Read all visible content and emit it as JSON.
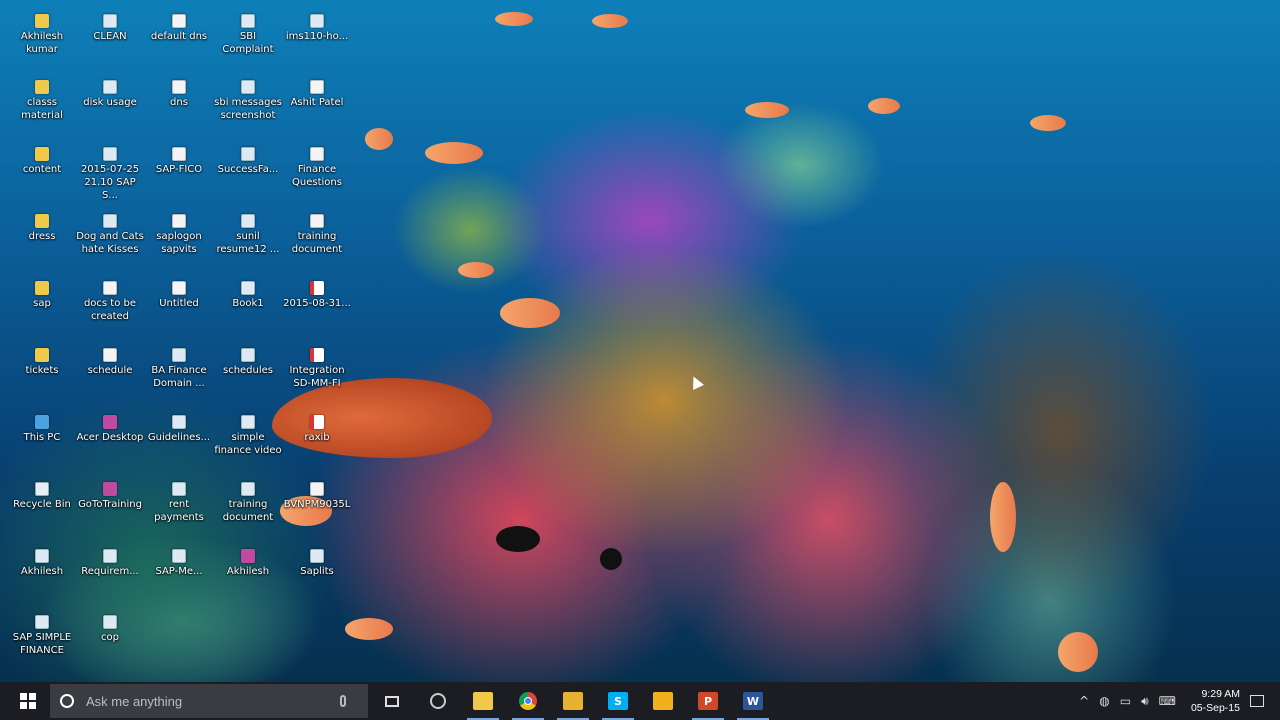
{
  "desktop": {
    "icons": [
      {
        "label": "Akhilesh\nkumar",
        "type": "folder"
      },
      {
        "label": "CLEAN",
        "type": "shortcut"
      },
      {
        "label": "default dns",
        "type": "doc"
      },
      {
        "label": "SBI\nComplaint",
        "type": "shortcut"
      },
      {
        "label": "ims110-ho...",
        "type": "shortcut"
      },
      {
        "label": "classs\nmaterial",
        "type": "folder"
      },
      {
        "label": "disk usage",
        "type": "shortcut"
      },
      {
        "label": "dns",
        "type": "doc"
      },
      {
        "label": "sbi messages\nscreenshot",
        "type": "shortcut"
      },
      {
        "label": "Ashit Patel",
        "type": "doc"
      },
      {
        "label": "content",
        "type": "folder"
      },
      {
        "label": "2015-07-25\n21.10 SAP S...",
        "type": "shortcut"
      },
      {
        "label": "SAP-FICO",
        "type": "doc"
      },
      {
        "label": "SuccessFa...",
        "type": "shortcut"
      },
      {
        "label": "Finance\nQuestions",
        "type": "doc"
      },
      {
        "label": "dress",
        "type": "folder"
      },
      {
        "label": "Dog and Cats\nhate Kisses",
        "type": "shortcut"
      },
      {
        "label": "saplogon\nsapvits",
        "type": "doc"
      },
      {
        "label": "sunil\nresume12 ...",
        "type": "shortcut"
      },
      {
        "label": "training\ndocument",
        "type": "doc"
      },
      {
        "label": "sap",
        "type": "folder"
      },
      {
        "label": "docs to be\ncreated",
        "type": "doc"
      },
      {
        "label": "Untitled",
        "type": "doc"
      },
      {
        "label": "Book1",
        "type": "shortcut"
      },
      {
        "label": "2015-08-31...",
        "type": "pdf"
      },
      {
        "label": "tickets",
        "type": "folder"
      },
      {
        "label": "schedule",
        "type": "doc"
      },
      {
        "label": "BA Finance\nDomain ...",
        "type": "shortcut"
      },
      {
        "label": "schedules",
        "type": "shortcut"
      },
      {
        "label": "Integration\nSD-MM-FI",
        "type": "pdf"
      },
      {
        "label": "This PC",
        "type": "pc"
      },
      {
        "label": "Acer Desktop",
        "type": "app"
      },
      {
        "label": "Guidelines...",
        "type": "shortcut"
      },
      {
        "label": "simple\nfinance video",
        "type": "shortcut"
      },
      {
        "label": "raxib",
        "type": "pdf"
      },
      {
        "label": "Recycle Bin",
        "type": "bin"
      },
      {
        "label": "GoToTraining",
        "type": "app"
      },
      {
        "label": "rent\npayments",
        "type": "shortcut"
      },
      {
        "label": "training\ndocument",
        "type": "shortcut"
      },
      {
        "label": "BVNPM9035L",
        "type": "doc"
      },
      {
        "label": "Akhilesh",
        "type": "shortcut"
      },
      {
        "label": "Requirem...",
        "type": "shortcut"
      },
      {
        "label": "SAP-Me...",
        "type": "shortcut"
      },
      {
        "label": "Akhilesh",
        "type": "app"
      },
      {
        "label": "Saplits",
        "type": "shortcut"
      },
      {
        "label": "SAP SIMPLE\nFINANCE",
        "type": "shortcut"
      },
      {
        "label": "cop",
        "type": "shortcut"
      }
    ]
  },
  "taskbar": {
    "search_placeholder": "Ask me anything",
    "apps": [
      {
        "name": "cortana-search-app",
        "icon": "search-icon",
        "active": false
      },
      {
        "name": "file-explorer",
        "icon": "folder-icon",
        "active": true,
        "color": "#f0c94a"
      },
      {
        "name": "chrome",
        "icon": "chrome-icon",
        "active": true
      },
      {
        "name": "sticky-app",
        "icon": "app-icon",
        "active": true,
        "color": "#e8b230"
      },
      {
        "name": "skype",
        "icon": "skype-icon",
        "active": true,
        "color": "#00aff0",
        "letter": "S"
      },
      {
        "name": "teamviewer-app",
        "icon": "gear-icon",
        "active": false,
        "color": "#f2b01e"
      },
      {
        "name": "powerpoint",
        "icon": "powerpoint-icon",
        "active": true,
        "color": "#d24726",
        "letter": "P"
      },
      {
        "name": "word",
        "icon": "word-icon",
        "active": true,
        "color": "#2b579a",
        "letter": "W"
      }
    ],
    "clock": {
      "time": "9:29 AM",
      "date": "05-Sep-15"
    }
  }
}
